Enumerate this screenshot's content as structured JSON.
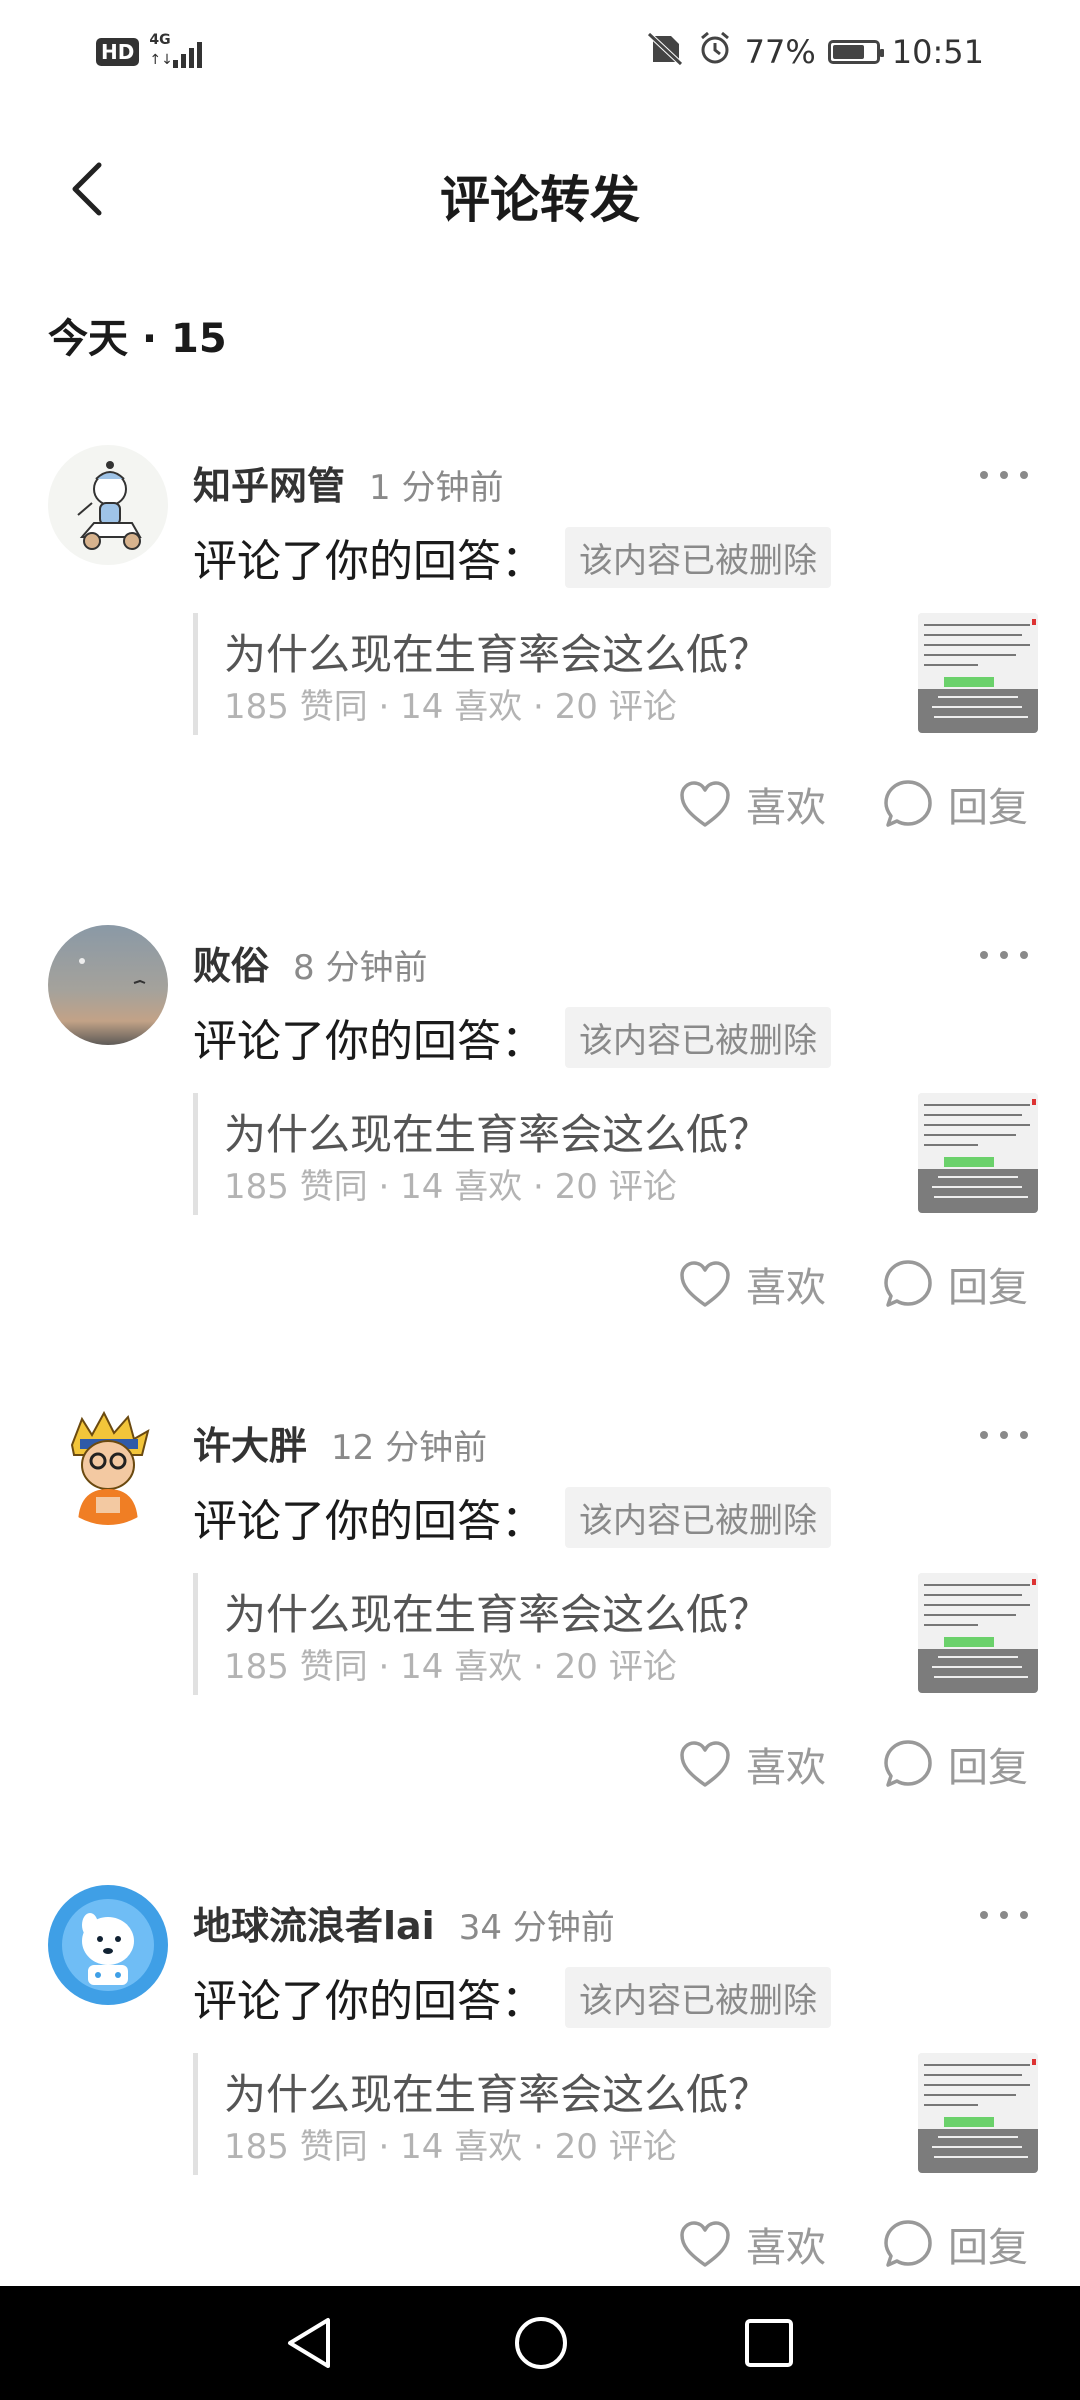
{
  "status_bar": {
    "hd": "HD",
    "network": "4G",
    "battery": "77%",
    "battery_level": 0.77,
    "time": "10:51"
  },
  "header": {
    "title": "评论转发"
  },
  "section": {
    "title": "今天 · 15"
  },
  "items": [
    {
      "user": "知乎网管",
      "time": "1 分钟前",
      "action": "评论了你的回答：",
      "deleted_note": "该内容已被删除",
      "question": "为什么现在生育率会这么低？",
      "stats": "185 赞同 · 14 喜欢 · 20 评论",
      "like_label": "喜欢",
      "reply_label": "回复"
    },
    {
      "user": "败俗",
      "time": "8 分钟前",
      "action": "评论了你的回答：",
      "deleted_note": "该内容已被删除",
      "question": "为什么现在生育率会这么低？",
      "stats": "185 赞同 · 14 喜欢 · 20 评论",
      "like_label": "喜欢",
      "reply_label": "回复"
    },
    {
      "user": "许大胖",
      "time": "12 分钟前",
      "action": "评论了你的回答：",
      "deleted_note": "该内容已被删除",
      "question": "为什么现在生育率会这么低？",
      "stats": "185 赞同 · 14 喜欢 · 20 评论",
      "like_label": "喜欢",
      "reply_label": "回复"
    },
    {
      "user": "地球流浪者lai",
      "time": "34 分钟前",
      "action": "评论了你的回答：",
      "deleted_note": "该内容已被删除",
      "question": "为什么现在生育率会这么低？",
      "stats": "185 赞同 · 14 喜欢 · 20 评论",
      "like_label": "喜欢",
      "reply_label": "回复"
    }
  ],
  "icons": {
    "back": "chevron-left-icon",
    "more": "more-dots-icon",
    "like": "heart-icon",
    "reply": "comment-bubble-icon",
    "nav": [
      "triangle-back-icon",
      "circle-home-icon",
      "square-recents-icon"
    ]
  },
  "colors": {
    "background": "#ffffff",
    "text_primary": "#1a1a1a",
    "text_secondary": "#8a8a8a",
    "text_faint": "#b3b3b3",
    "nav_bar": "#000000"
  }
}
